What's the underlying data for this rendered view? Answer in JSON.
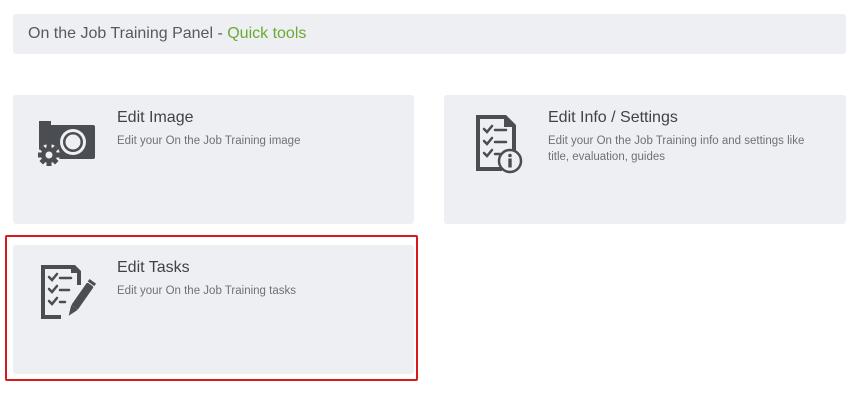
{
  "header": {
    "panel_title": "On the Job Training Panel",
    "separator": " - ",
    "quick_tools": "Quick tools",
    "quick_tools_color": "#6aaa33"
  },
  "cards": [
    {
      "icon": "camera-gear-icon",
      "title": "Edit Image",
      "description": "Edit your On the Job Training image"
    },
    {
      "icon": "checklist-info-icon",
      "title": "Edit Info / Settings",
      "description": "Edit your On the Job Training info and settings like title, evaluation, guides"
    },
    {
      "icon": "checklist-pen-icon",
      "title": "Edit Tasks",
      "description": "Edit your On the Job Training tasks"
    }
  ],
  "colors": {
    "card_background": "#eeeff2",
    "icon": "#4a4d51",
    "highlight": "#d7191c"
  }
}
